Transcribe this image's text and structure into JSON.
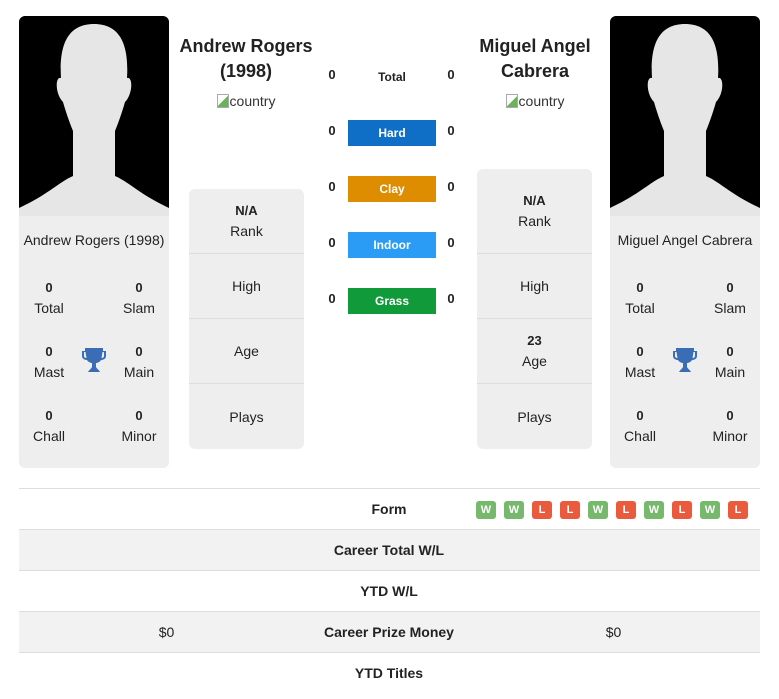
{
  "players": [
    {
      "name": "Andrew Rogers (1998)",
      "header_line1": "Andrew Rogers",
      "header_line2": "(1998)",
      "country_alt": "country",
      "titles": {
        "total": {
          "value": "0",
          "label": "Total"
        },
        "slam": {
          "value": "0",
          "label": "Slam"
        },
        "mast": {
          "value": "0",
          "label": "Mast"
        },
        "main": {
          "value": "0",
          "label": "Main"
        },
        "chall": {
          "value": "0",
          "label": "Chall"
        },
        "minor": {
          "value": "0",
          "label": "Minor"
        }
      },
      "info": {
        "rank": {
          "value": "N/A",
          "label": "Rank"
        },
        "high": {
          "value": "",
          "label": "High"
        },
        "age": {
          "value": "",
          "label": "Age"
        },
        "plays": {
          "value": "",
          "label": "Plays"
        }
      }
    },
    {
      "name": "Miguel Angel Cabrera",
      "header_line1": "Miguel Angel",
      "header_line2": "Cabrera",
      "country_alt": "country",
      "titles": {
        "total": {
          "value": "0",
          "label": "Total"
        },
        "slam": {
          "value": "0",
          "label": "Slam"
        },
        "mast": {
          "value": "0",
          "label": "Mast"
        },
        "main": {
          "value": "0",
          "label": "Main"
        },
        "chall": {
          "value": "0",
          "label": "Chall"
        },
        "minor": {
          "value": "0",
          "label": "Minor"
        }
      },
      "info": {
        "rank": {
          "value": "N/A",
          "label": "Rank"
        },
        "high": {
          "value": "",
          "label": "High"
        },
        "age": {
          "value": "23",
          "label": "Age"
        },
        "plays": {
          "value": "",
          "label": "Plays"
        }
      }
    }
  ],
  "h2h": {
    "total": {
      "label": "Total",
      "left": "0",
      "right": "0"
    },
    "surfaces": [
      {
        "label": "Hard",
        "left": "0",
        "right": "0",
        "color": "#0f6fc6"
      },
      {
        "label": "Clay",
        "left": "0",
        "right": "0",
        "color": "#de8c00"
      },
      {
        "label": "Indoor",
        "left": "0",
        "right": "0",
        "color": "#2b9cf5"
      },
      {
        "label": "Grass",
        "left": "0",
        "right": "0",
        "color": "#119a3a"
      }
    ]
  },
  "table": {
    "form_label": "Form",
    "form": [
      "W",
      "W",
      "L",
      "L",
      "W",
      "L",
      "W",
      "L",
      "W",
      "L"
    ],
    "rows": [
      {
        "label": "Career Total W/L",
        "left": "",
        "right": ""
      },
      {
        "label": "YTD W/L",
        "left": "",
        "right": ""
      },
      {
        "label": "Career Prize Money",
        "left": "$0",
        "right": "$0"
      },
      {
        "label": "YTD Titles",
        "left": "",
        "right": ""
      }
    ]
  }
}
